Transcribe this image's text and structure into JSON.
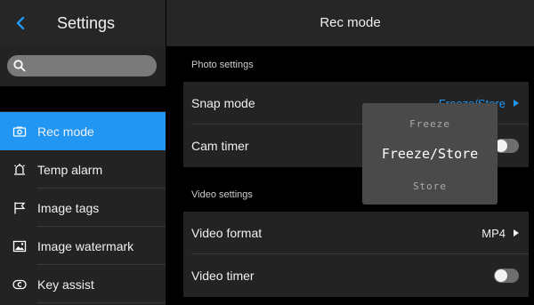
{
  "colors": {
    "accent": "#2196f3",
    "sidebar_bg": "#232323",
    "header_bg": "#262626",
    "popup_bg": "#4a4a4a"
  },
  "sidebar": {
    "back_icon": "chevron-left-icon",
    "title": "Settings",
    "search": {
      "icon": "search-icon",
      "value": "",
      "placeholder": ""
    },
    "items": [
      {
        "icon": "camera-icon",
        "label": "Rec mode",
        "active": true
      },
      {
        "icon": "alarm-bell-icon",
        "label": "Temp alarm",
        "active": false
      },
      {
        "icon": "flag-icon",
        "label": "Image tags",
        "active": false
      },
      {
        "icon": "image-watermark-icon",
        "label": "Image watermark",
        "active": false
      },
      {
        "icon": "key-assist-icon",
        "label": "Key assist",
        "active": false
      }
    ]
  },
  "main": {
    "title": "Rec mode",
    "photo_section": "Photo settings",
    "snap_mode": {
      "label": "Snap mode",
      "value": "Freeze/Store"
    },
    "cam_timer": {
      "label": "Cam timer",
      "on": false
    },
    "video_section": "Video settings",
    "video_format": {
      "label": "Video format",
      "value": "MP4"
    },
    "video_timer": {
      "label": "Video timer",
      "on": false
    }
  },
  "snap_dropdown": {
    "options": [
      "Freeze",
      "Freeze/Store",
      "Store"
    ],
    "selected": "Freeze/Store"
  }
}
